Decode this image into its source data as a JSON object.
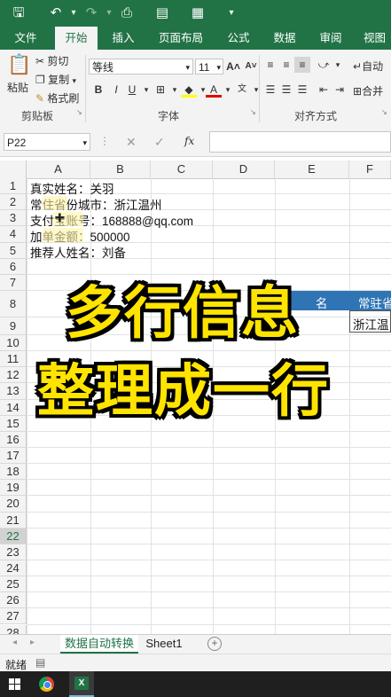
{
  "titlebar": {
    "save_icon": "save-icon",
    "undo_icon": "undo-icon",
    "redo_icon": "redo-icon",
    "preview_icon": "print-preview-icon",
    "form_icon": "form-icon",
    "more_icon": "customize-toolbar-icon"
  },
  "tabs": [
    {
      "label": "文件"
    },
    {
      "label": "开始"
    },
    {
      "label": "插入"
    },
    {
      "label": "页面布局"
    },
    {
      "label": "公式"
    },
    {
      "label": "数据"
    },
    {
      "label": "审阅"
    },
    {
      "label": "视图"
    }
  ],
  "ribbon": {
    "paste": "粘贴",
    "cut": "剪切",
    "copy": "复制",
    "format_painter": "格式刷",
    "clipboard_group": "剪贴板",
    "font_name": "等线",
    "font_size": "11",
    "bold": "B",
    "italic": "I",
    "underline": "U",
    "font_group": "字体",
    "wrap": "自动",
    "merge": "合并",
    "align_group": "对齐方式"
  },
  "formula_bar": {
    "name_box": "P22",
    "fx": "fx",
    "value": ""
  },
  "columns": [
    "A",
    "B",
    "C",
    "D",
    "E",
    "F"
  ],
  "rows": [
    "1",
    "2",
    "3",
    "4",
    "5",
    "6",
    "7",
    "8",
    "9",
    "10",
    "11",
    "12",
    "13",
    "14",
    "15",
    "16",
    "17",
    "18",
    "19",
    "20",
    "21",
    "22",
    "23",
    "24",
    "25",
    "26",
    "27",
    "28"
  ],
  "selected_row": "22",
  "cells": {
    "a1": "真实姓名：关羽",
    "a2": "常住省份城市：浙江温州",
    "a3": "支付宝账号：168888@qq.com",
    "a4": "加单金额：500000",
    "a5": "推荐人姓名：刘备",
    "e8": "名",
    "f8": "常驻省",
    "f9": "浙江温"
  },
  "overlay": {
    "line1": "多行信息",
    "line2": "整理成一行"
  },
  "sheets": [
    {
      "label": "数据自动转换",
      "active": true
    },
    {
      "label": "Sheet1",
      "active": false
    }
  ],
  "status": {
    "ready": "就绪"
  },
  "colors": {
    "excel_green": "#217346",
    "caption_yellow": "#ffe400",
    "header_blue": "#2f75b5"
  }
}
